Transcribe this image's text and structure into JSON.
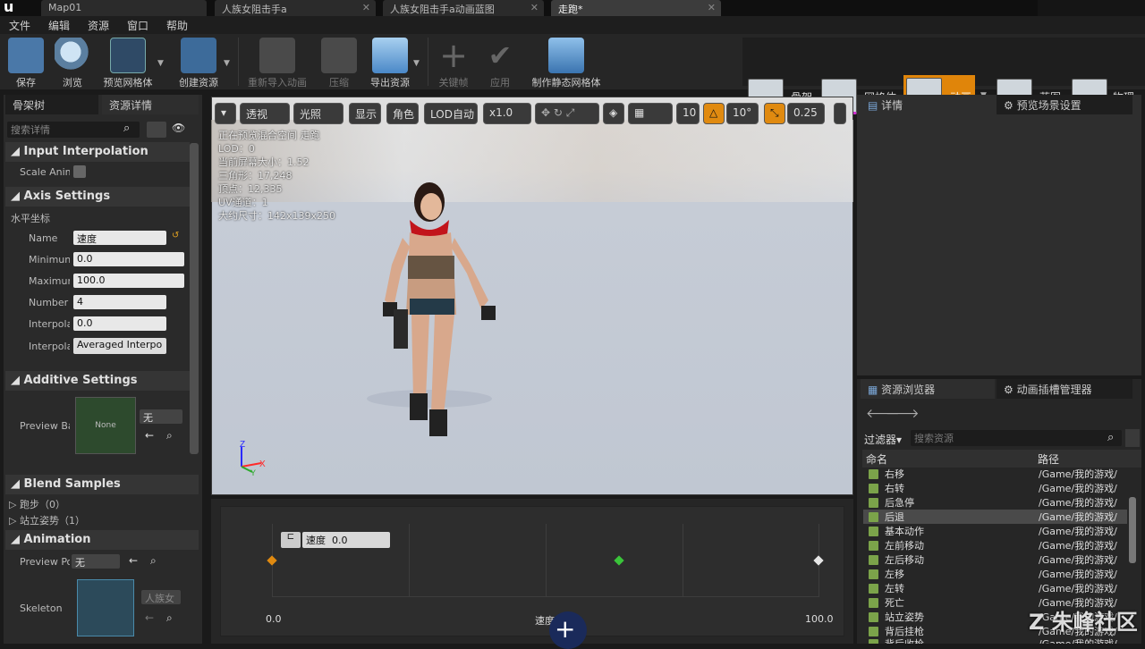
{
  "app": {
    "logo": "u",
    "doc_tabs": [
      "Map01",
      "人族女阻击手a",
      "人族女阻击手a动画蓝图",
      "走跑*"
    ]
  },
  "menu": [
    "文件",
    "编辑",
    "资源",
    "窗口",
    "帮助"
  ],
  "toolbar": [
    {
      "label": "保存",
      "icon": "save-icon"
    },
    {
      "label": "浏览",
      "icon": "browse-icon"
    },
    {
      "label": "预览网格体",
      "icon": "preview-mesh-icon"
    },
    {
      "label": "创建资源",
      "icon": "create-asset-icon"
    },
    {
      "label": "重新导入动画",
      "icon": "reimport-icon"
    },
    {
      "label": "压缩",
      "icon": "compress-icon"
    },
    {
      "label": "导出资源",
      "icon": "export-icon"
    },
    {
      "label": "关键帧",
      "icon": "plus-icon"
    },
    {
      "label": "应用",
      "icon": "check-icon"
    },
    {
      "label": "制作静态网格体",
      "icon": "make-static-mesh-icon"
    }
  ],
  "modes": [
    {
      "label": "骨架"
    },
    {
      "label": "网格体"
    },
    {
      "label": "动画"
    },
    {
      "label": "蓝图"
    },
    {
      "label": "物理"
    }
  ],
  "left": {
    "tabs": [
      "骨架树",
      "资源详情"
    ],
    "search_placeholder": "搜索详情",
    "sections": {
      "input_interp": "Input Interpolation",
      "scale_anim": "Scale Anim",
      "axis_settings": "Axis Settings",
      "horizontal": "水平坐标",
      "name_label": "Name",
      "name_value": "速度",
      "min_label": "Minimun",
      "min_value": "0.0",
      "max_label": "Maximun",
      "max_value": "100.0",
      "number_label": "Number c",
      "number_value": "4",
      "interp1_label": "Interpola",
      "interp1_value": "0.0",
      "interp2_label": "Interpola",
      "interp2_value": "Averaged Interpo",
      "additive": "Additive Settings",
      "preview_base_label": "Preview Ba",
      "preview_base_none": "None",
      "preview_base_select": "无",
      "blend_samples": "Blend Samples",
      "sample1": "跑步（0）",
      "sample2": "站立姿势（1）",
      "animation": "Animation",
      "preview_pose_label": "Preview Po",
      "preview_pose_value": "无",
      "skeleton_label": "Skeleton",
      "skeleton_value": "人族女"
    }
  },
  "viewport": {
    "buttons": [
      "透视",
      "光照",
      "显示",
      "角色",
      "LOD自动",
      "x1.0",
      "10",
      "10°",
      "0.25"
    ],
    "info": [
      "正在预览混合空间 走跑",
      "LOD：0",
      "当前屏幕大小：1.52",
      "三角形：17,248",
      "顶点：12,335",
      "UV通道：1",
      "大约尺寸：142x139x250"
    ]
  },
  "blendspace": {
    "param_label": "速度",
    "param_value": "0.0",
    "axis_min": "0.0",
    "axis_mid": "速度",
    "axis_max": "100.0"
  },
  "right": {
    "tabs": [
      "详情",
      "预览场景设置"
    ],
    "bottom_tabs": [
      "资源浏览器",
      "动画插槽管理器"
    ],
    "filter": "过滤器",
    "search_placeholder": "搜索资源",
    "col_name": "命名",
    "col_path": "路径",
    "rows": [
      {
        "name": "右移",
        "path": "/Game/我的游戏/"
      },
      {
        "name": "右转",
        "path": "/Game/我的游戏/"
      },
      {
        "name": "后急停",
        "path": "/Game/我的游戏/"
      },
      {
        "name": "后退",
        "path": "/Game/我的游戏/"
      },
      {
        "name": "基本动作",
        "path": "/Game/我的游戏/"
      },
      {
        "name": "左前移动",
        "path": "/Game/我的游戏/"
      },
      {
        "name": "左后移动",
        "path": "/Game/我的游戏/"
      },
      {
        "name": "左移",
        "path": "/Game/我的游戏/"
      },
      {
        "name": "左转",
        "path": "/Game/我的游戏/"
      },
      {
        "name": "死亡",
        "path": "/Game/我的游戏/"
      },
      {
        "name": "站立姿势",
        "path": "/Game/我的游戏/"
      },
      {
        "name": "背后挂枪",
        "path": "/Game/我的游戏/"
      },
      {
        "name": "背后收枪",
        "path": "/Game/我的游戏/"
      }
    ]
  },
  "watermark": "朱峰社区"
}
